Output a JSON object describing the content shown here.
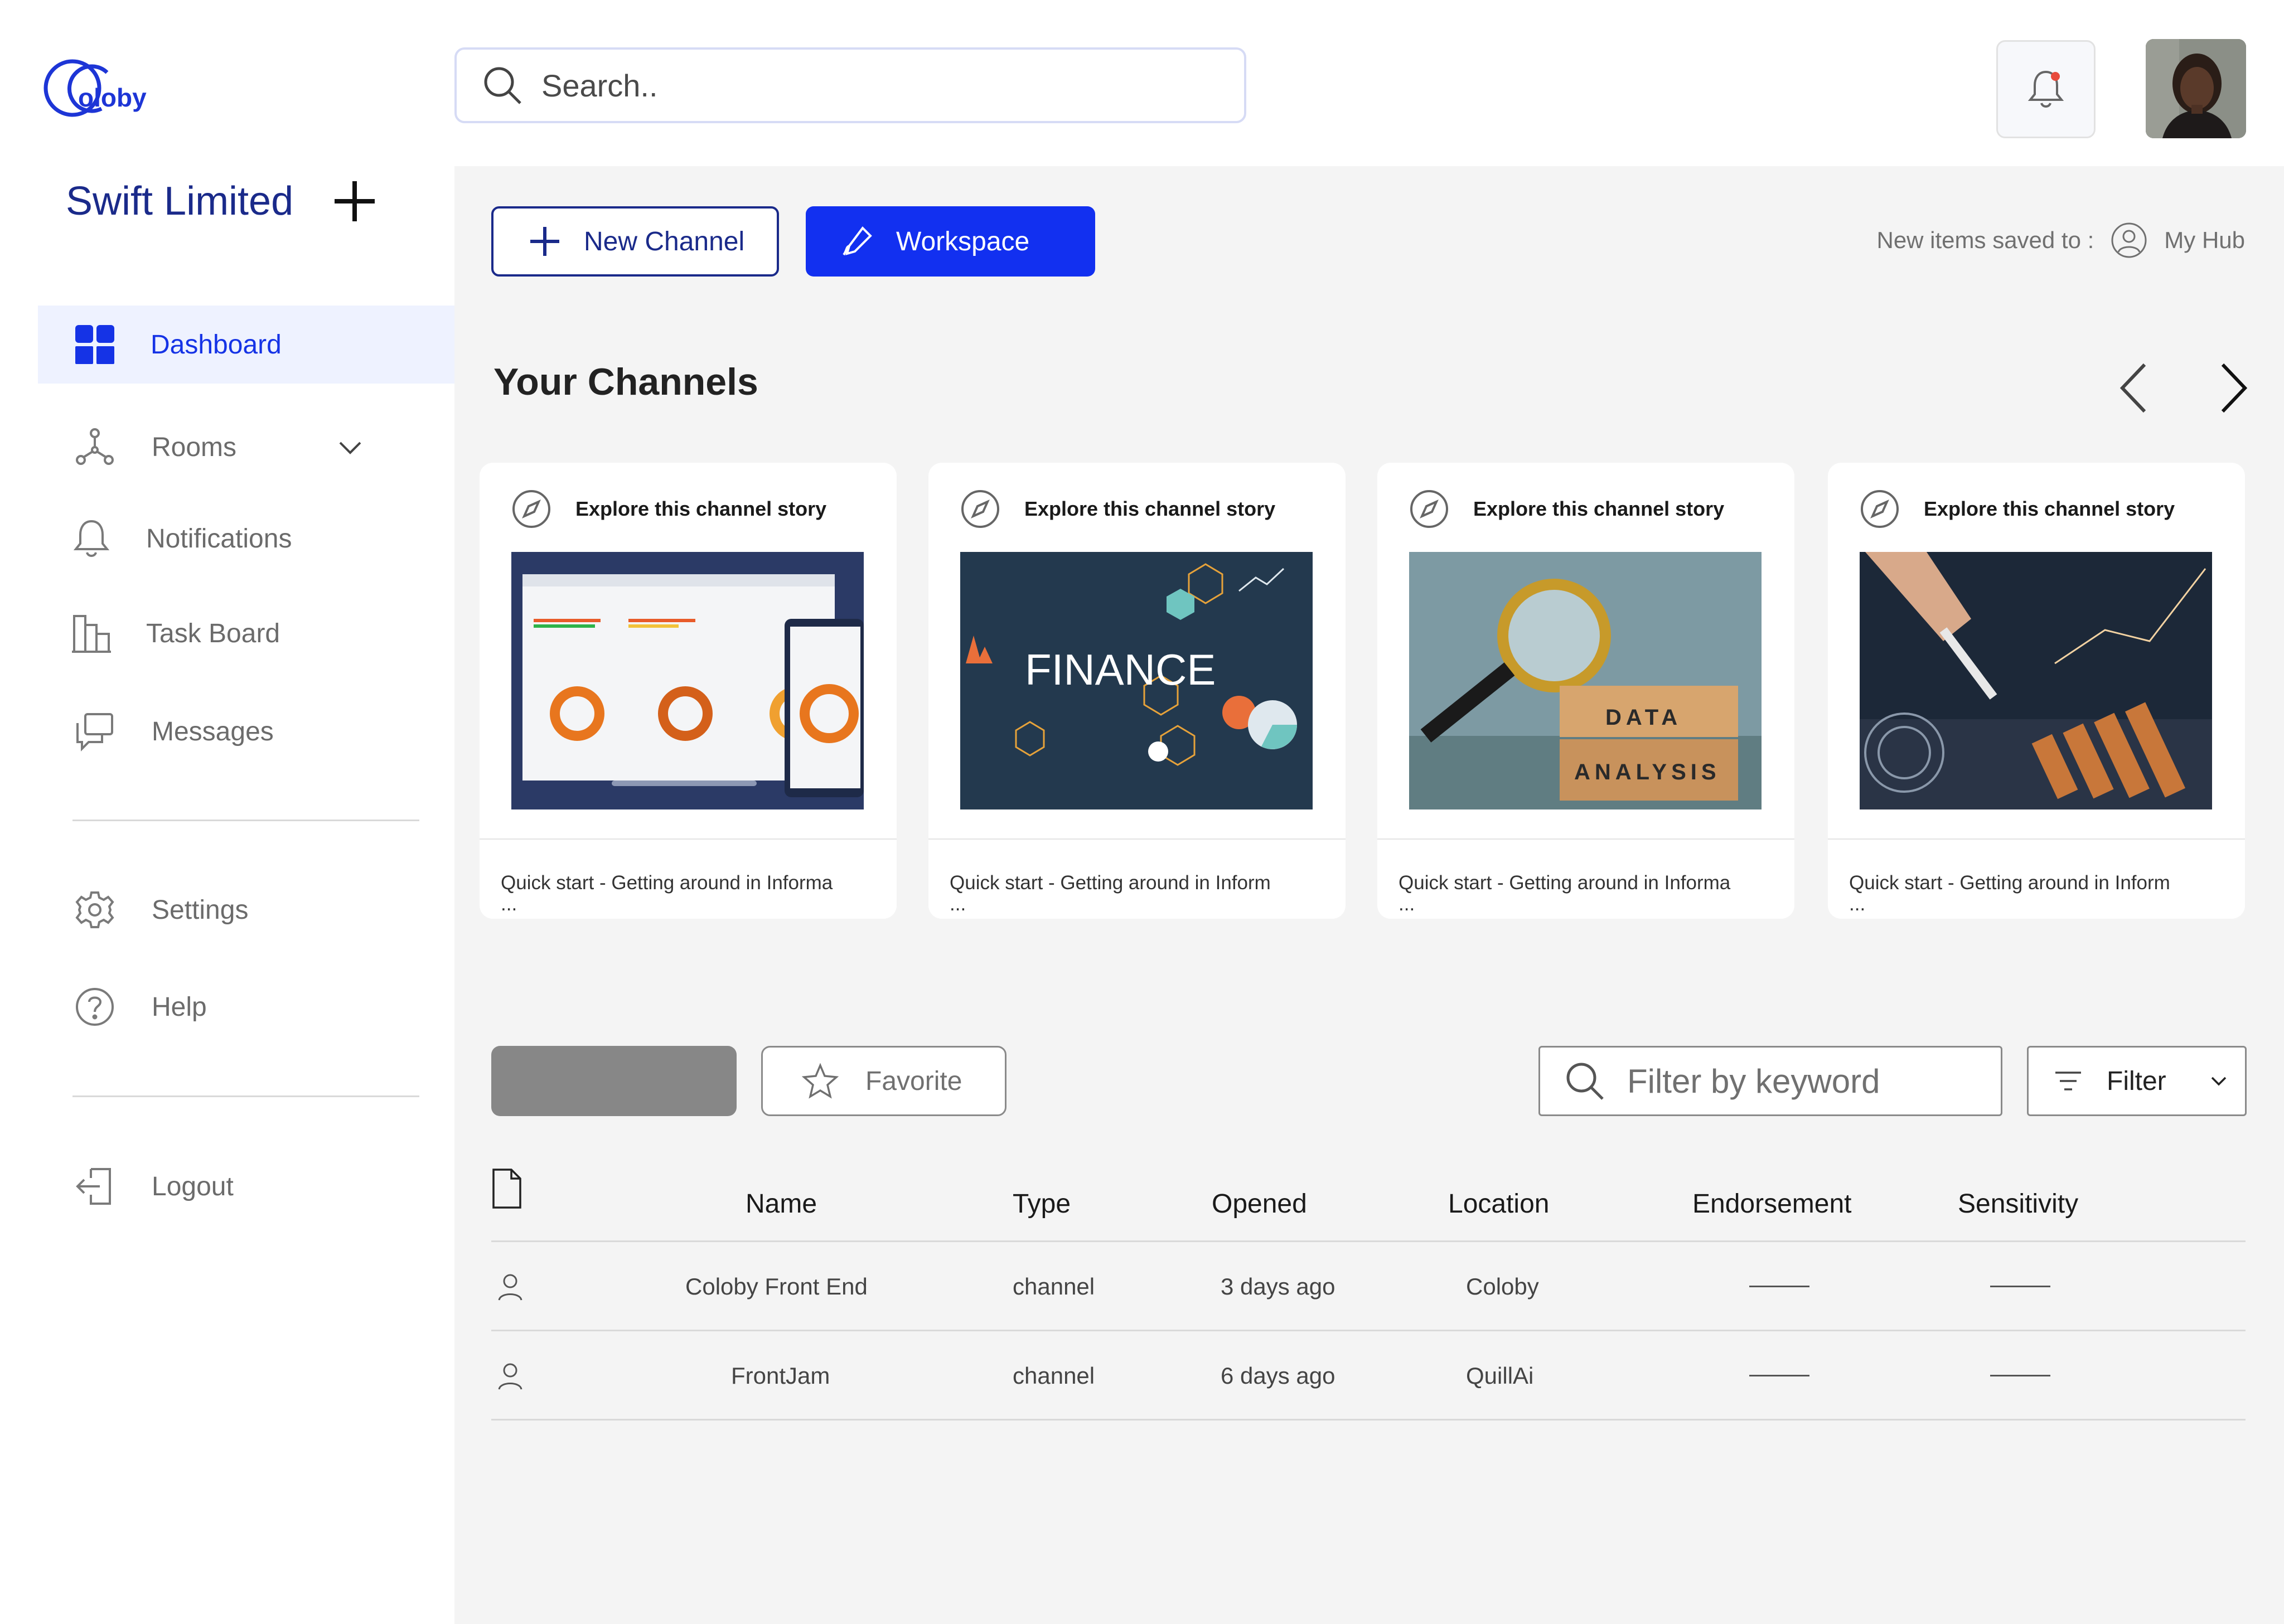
{
  "brand": {
    "logo_text": "oloby",
    "accent": "#1533e6"
  },
  "org": {
    "name": "Swift Limited",
    "add_icon": "plus-icon"
  },
  "nav": {
    "items": [
      {
        "label": "Dashboard",
        "icon": "dashboard-icon",
        "active": true
      },
      {
        "label": "Rooms",
        "icon": "rooms-icon",
        "expandable": true
      },
      {
        "label": "Notifications",
        "icon": "bell-icon"
      },
      {
        "label": "Task Board",
        "icon": "task-board-icon"
      },
      {
        "label": "Messages",
        "icon": "messages-icon"
      },
      {
        "label": "Settings",
        "icon": "gear-icon"
      },
      {
        "label": "Help",
        "icon": "help-icon"
      },
      {
        "label": "Logout",
        "icon": "logout-icon"
      }
    ]
  },
  "header": {
    "search_placeholder": "Search.."
  },
  "toolbar": {
    "new_channel_label": "New Channel",
    "workspace_label": "Workspace",
    "saved_to_label": "New items saved to :",
    "saved_to_target": "My Hub"
  },
  "channels": {
    "title": "Your Channels",
    "cards": [
      {
        "header": "Explore this channel story",
        "caption": "Quick start - Getting around in Informa",
        "more": "...",
        "thumb": "dashboard-laptop-image"
      },
      {
        "header": "Explore this channel story",
        "caption": "Quick start - Getting around in Inform",
        "more": "...",
        "thumb": "finance-image",
        "thumb_text": "FINANCE"
      },
      {
        "header": "Explore this channel story",
        "caption": "Quick start - Getting around in Informa",
        "more": "...",
        "thumb": "data-analysis-image",
        "thumb_text": [
          "DATA",
          "ANALYSIS"
        ]
      },
      {
        "header": "Explore this channel story",
        "caption": "Quick start - Getting around in Inform",
        "more": "...",
        "thumb": "stylus-charts-image"
      }
    ]
  },
  "list": {
    "favorite_label": "Favorite",
    "filter_placeholder": "Filter by keyword",
    "filter_label": "Filter",
    "columns": [
      "Name",
      "Type",
      "Opened",
      "Location",
      "Endorsement",
      "Sensitivity"
    ],
    "rows": [
      {
        "name": "Coloby Front End",
        "type": "channel",
        "opened": "3 days ago",
        "location": "Coloby"
      },
      {
        "name": "FrontJam",
        "type": "channel",
        "opened": "6 days ago",
        "location": "QuillAi"
      }
    ]
  }
}
